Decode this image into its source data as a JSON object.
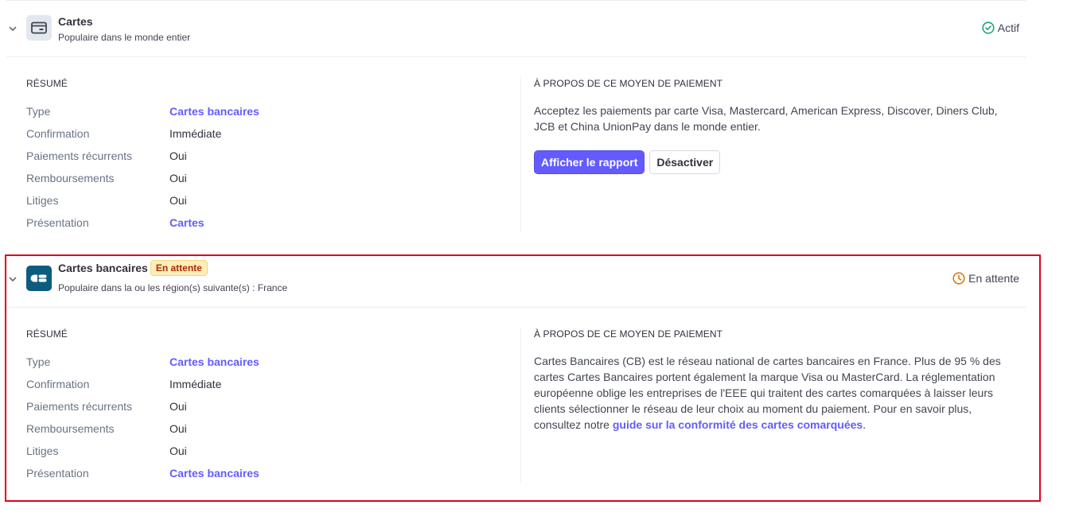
{
  "methods": [
    {
      "name": "Cartes",
      "subtitle": "Populaire dans le monde entier",
      "status": "Actif",
      "logo_icon": "credit-card-icon",
      "summary": {
        "title": "RÉSUMÉ",
        "rows": [
          {
            "label": "Type",
            "value": "Cartes bancaires"
          },
          {
            "label": "Confirmation",
            "value": "Immédiate"
          },
          {
            "label": "Paiements récurrents",
            "value": "Oui"
          },
          {
            "label": "Remboursements",
            "value": "Oui"
          },
          {
            "label": "Litiges",
            "value": "Oui"
          },
          {
            "label": "Présentation",
            "value": "Cartes"
          }
        ]
      },
      "about": {
        "title": "À PROPOS DE CE MOYEN DE PAIEMENT",
        "text": "Acceptez les paiements par carte Visa, Mastercard, American Express, Discover, Diners Club, JCB et China UnionPay dans le monde entier.",
        "primary_button": "Afficher le rapport",
        "secondary_button": "Désactiver"
      }
    },
    {
      "name": "Cartes bancaires",
      "badge": "En attente",
      "subtitle": "Populaire dans la ou les région(s) suivante(s) : France",
      "status": "En attente",
      "logo_text": "CB",
      "summary": {
        "title": "RÉSUMÉ",
        "rows": [
          {
            "label": "Type",
            "value": "Cartes bancaires"
          },
          {
            "label": "Confirmation",
            "value": "Immédiate"
          },
          {
            "label": "Paiements récurrents",
            "value": "Oui"
          },
          {
            "label": "Remboursements",
            "value": "Oui"
          },
          {
            "label": "Litiges",
            "value": "Oui"
          },
          {
            "label": "Présentation",
            "value": "Cartes bancaires"
          }
        ]
      },
      "about": {
        "title": "À PROPOS DE CE MOYEN DE PAIEMENT",
        "text": "Cartes Bancaires (CB) est le réseau national de cartes bancaires en France. Plus de 95 % des cartes Cartes Bancaires portent également la marque Visa ou MasterCard. La réglementation européenne oblige les entreprises de l'EEE qui traitent des cartes comarquées à laisser leurs clients sélectionner le réseau de leur choix au moment du paiement. Pour en savoir plus, consultez notre ",
        "link": "guide sur la conformité des cartes comarquées",
        "text_end": "."
      }
    }
  ],
  "colors": {
    "accent": "#635bff",
    "active_status": "#1ea672",
    "pending_status": "#d97917",
    "highlight_border": "#e0001b"
  }
}
